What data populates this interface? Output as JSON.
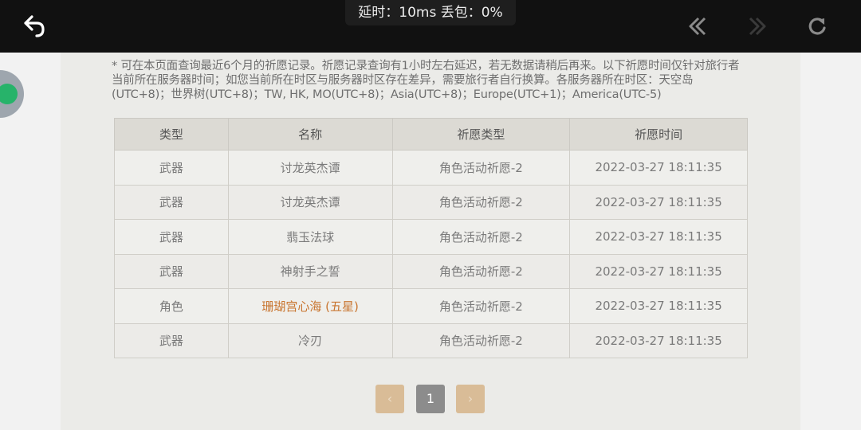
{
  "status": {
    "latency_text": "延时：10ms 丢包：0%"
  },
  "icons": {
    "back": "back-arrow-icon",
    "prev": "prev-icon",
    "next": "next-icon",
    "refresh": "refresh-icon"
  },
  "colors": {
    "rare_item": "#c8742e",
    "float_ball": "#27b36a"
  },
  "notice": "* 可在本页面查询最近6个月的祈愿记录。祈愿记录查询有1小时左右延迟，若无数据请稍后再来。以下祈愿时间仅针对旅行者当前所在服务器时间；如您当前所在时区与服务器时区存在差异，需要旅行者自行换算。各服务器所在时区：天空岛(UTC+8)；世界树(UTC+8)；TW, HK, MO(UTC+8)；Asia(UTC+8)；Europe(UTC+1)；America(UTC-5)",
  "table": {
    "headers": [
      "类型",
      "名称",
      "祈愿类型",
      "祈愿时间"
    ],
    "rows": [
      [
        "武器",
        "讨龙英杰谭",
        "角色活动祈愿-2",
        "2022-03-27 18:11:35"
      ],
      [
        "武器",
        "讨龙英杰谭",
        "角色活动祈愿-2",
        "2022-03-27 18:11:35"
      ],
      [
        "武器",
        "翡玉法球",
        "角色活动祈愿-2",
        "2022-03-27 18:11:35"
      ],
      [
        "武器",
        "神射手之誓",
        "角色活动祈愿-2",
        "2022-03-27 18:11:35"
      ],
      [
        "角色",
        "珊瑚宫心海 (五星)",
        "角色活动祈愿-2",
        "2022-03-27 18:11:35"
      ],
      [
        "武器",
        "冷刃",
        "角色活动祈愿-2",
        "2022-03-27 18:11:35"
      ]
    ]
  },
  "pagination": {
    "prev": "‹",
    "current": "1",
    "next": "›"
  }
}
